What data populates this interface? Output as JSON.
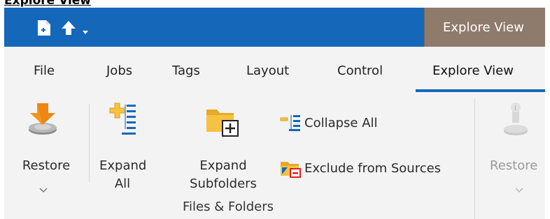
{
  "caption": "Explore View",
  "titlebar": {
    "context_tab": "Explore View",
    "quick_access": [
      "new-document-icon",
      "upload-arrow-icon",
      "customize-dropdown-icon"
    ]
  },
  "tabs": [
    "File",
    "Jobs",
    "Tags",
    "Layout",
    "Control",
    "Explore View"
  ],
  "active_tab": "Explore View",
  "ribbon": {
    "restore": {
      "label": "Restore"
    },
    "expand_all": {
      "line1": "Expand",
      "line2": "All"
    },
    "expand_subfolders": {
      "line1": "Expand",
      "line2": "Subfolders"
    },
    "collapse_all": {
      "label": "Collapse All"
    },
    "exclude_from_sources": {
      "label": "Exclude from Sources"
    },
    "group_label": "Files & Folders",
    "restore_disabled": {
      "label": "Restore"
    }
  },
  "colors": {
    "titlebar": "#1467b9",
    "context_tab": "#8f7b6b",
    "ribbon": "#f3f3f3",
    "accent_orange": "#f7931e",
    "folder_yellow": "#f5c242"
  }
}
